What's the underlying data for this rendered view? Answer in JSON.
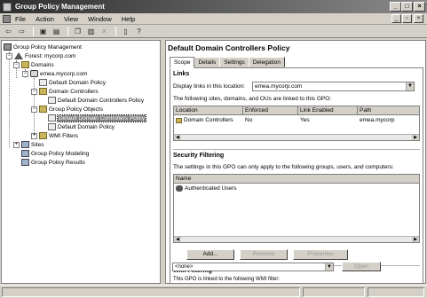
{
  "window": {
    "title": "Group Policy Management"
  },
  "menu": [
    "File",
    "Action",
    "View",
    "Window",
    "Help"
  ],
  "tree": {
    "root": "Group Policy Management",
    "forest": "Forest: mycorp.com",
    "domains": "Domains",
    "domain": "emea.mycorp.com",
    "default_domain_policy": "Default Domain Policy",
    "domain_controllers": "Domain Controllers",
    "dc_policy_link": "Default Domain Controllers Policy",
    "gpo_folder": "Group Policy Objects",
    "gpo_dc_policy": "Default Domain Controllers Policy",
    "gpo_domain_policy": "Default Domain Policy",
    "wmi_filters": "WMI Filters",
    "sites": "Sites",
    "modeling": "Group Policy Modeling",
    "results": "Group Policy Results"
  },
  "detail": {
    "title": "Default Domain Controllers Policy",
    "tabs": [
      "Scope",
      "Details",
      "Settings",
      "Delegation"
    ],
    "links": {
      "heading": "Links",
      "display_label": "Display links in this location:",
      "location_value": "emea.mycorp.com",
      "linked_text": "The following sites, domains, and OUs are linked to this GPO:",
      "columns": [
        "Location",
        "Enforced",
        "Link Enabled",
        "Path"
      ],
      "rows": [
        {
          "location": "Domain Controllers",
          "enforced": "No",
          "enabled": "Yes",
          "path": "emea.mycorp"
        }
      ]
    },
    "security": {
      "heading": "Security Filtering",
      "text": "The settings in this GPO can only apply to the following groups, users, and computers:",
      "column": "Name",
      "rows": [
        "Authenticated Users"
      ],
      "add": "Add...",
      "remove": "Remove",
      "properties": "Properties"
    },
    "wmi": {
      "heading": "WMI Filtering",
      "text": "This GPO is linked to the following WMI filter:",
      "value": "<none>",
      "open": "Open"
    }
  }
}
